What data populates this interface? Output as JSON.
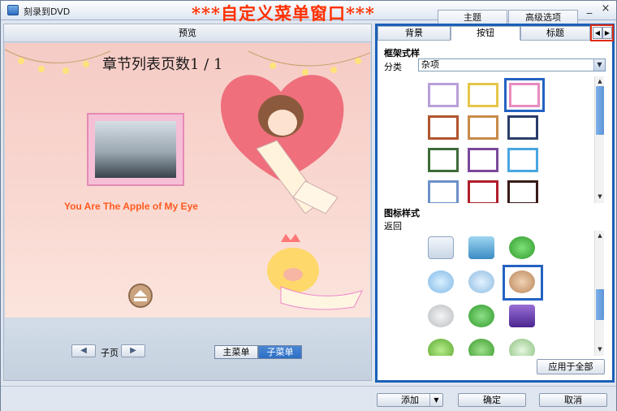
{
  "window": {
    "title": "刻录到DVD",
    "banner": "***自定义菜单窗口***",
    "min": "_",
    "close": "×"
  },
  "top_tabs": [
    {
      "label": "主题"
    },
    {
      "label": "高级选项"
    }
  ],
  "preview": {
    "header": "预览",
    "page_title": "章节列表页数1 / 1",
    "chapter_caption": "You Are The Apple of My Eye",
    "subpage_label": "子页",
    "prev_arrow": "◀",
    "next_arrow": "▶",
    "segments": [
      {
        "label": "主菜单"
      },
      {
        "label": "子菜单"
      }
    ]
  },
  "right_panel": {
    "tabs": [
      {
        "label": "背景"
      },
      {
        "label": "按钮"
      },
      {
        "label": "标题"
      }
    ],
    "tab_left_arrow": "◀",
    "tab_right_arrow": "▶",
    "frame_section": "框架式样",
    "category_label": "分类",
    "category_value": "杂项",
    "dropdown_arrow": "▼",
    "icon_section": "图标样式",
    "icon_sub": "返回",
    "apply_all": "应用于全部",
    "scroll_up": "▲",
    "scroll_down": "▼"
  },
  "bottom": {
    "add": "添加",
    "add_arrow": "▼",
    "ok": "确定",
    "cancel": "取消"
  },
  "colors": {
    "accent": "#1b5fb8",
    "banner": "#ff3000",
    "caption": "#ff5a1f",
    "selected_segment": "#2d6fc4"
  }
}
